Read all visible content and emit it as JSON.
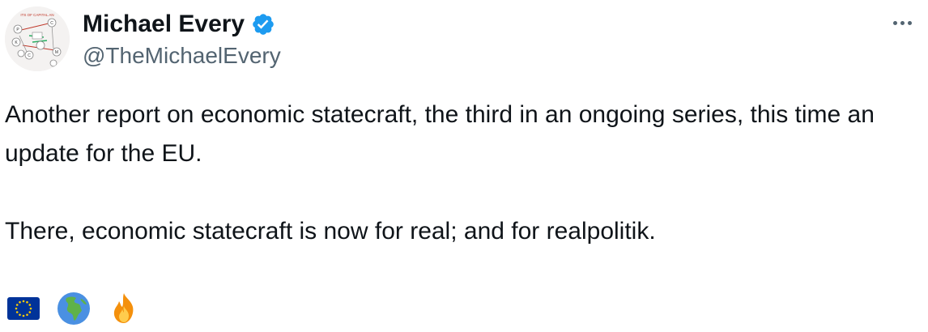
{
  "author": {
    "display_name": "Michael Every",
    "handle": "@TheMichaelEvery",
    "verified": true,
    "verified_color": "#1d9bf0",
    "avatar_icon": "economic-circuit-diagram-avatar"
  },
  "more_menu": {
    "icon": "more-horizontal-icon"
  },
  "tweet": {
    "paragraphs": [
      "Another report on economic statecraft, the third in an ongoing series, this time an update for the EU.",
      "There, economic statecraft is now for real; and for realpolitik."
    ],
    "emojis": [
      {
        "name": "eu-flag-emoji"
      },
      {
        "name": "globe-africa-europe-emoji"
      },
      {
        "name": "fire-emoji"
      }
    ]
  }
}
